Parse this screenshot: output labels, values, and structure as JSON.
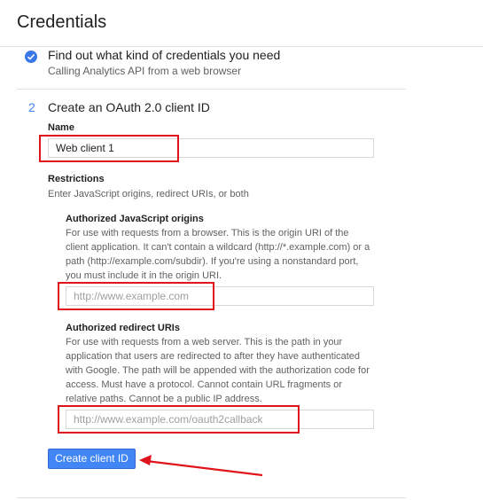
{
  "header": {
    "title": "Credentials"
  },
  "step1": {
    "title": "Find out what kind of credentials you need",
    "subtitle": "Calling Analytics API from a web browser"
  },
  "step2": {
    "number": "2",
    "title": "Create an OAuth 2.0 client ID",
    "name_label": "Name",
    "name_value": "Web client 1",
    "restrictions_label": "Restrictions",
    "restrictions_help": "Enter JavaScript origins, redirect URIs, or both",
    "origins": {
      "label": "Authorized JavaScript origins",
      "help": "For use with requests from a browser. This is the origin URI of the client application. It can't contain a wildcard (http://*.example.com) or a path (http://example.com/subdir). If you're using a nonstandard port, you must include it in the origin URI.",
      "placeholder": "http://www.example.com"
    },
    "redirects": {
      "label": "Authorized redirect URIs",
      "help": "For use with requests from a web server. This is the path in your application that users are redirected to after they have authenticated with Google. The path will be appended with the authorization code for access. Must have a protocol. Cannot contain URL fragments or relative paths. Cannot be a public IP address.",
      "placeholder": "http://www.example.com/oauth2callback"
    },
    "create_button": "Create client ID"
  },
  "annotations": {
    "highlight_color": "#e0151c"
  },
  "icons": {
    "step1": "check-circle-icon",
    "arrow": "arrow-left-icon"
  }
}
